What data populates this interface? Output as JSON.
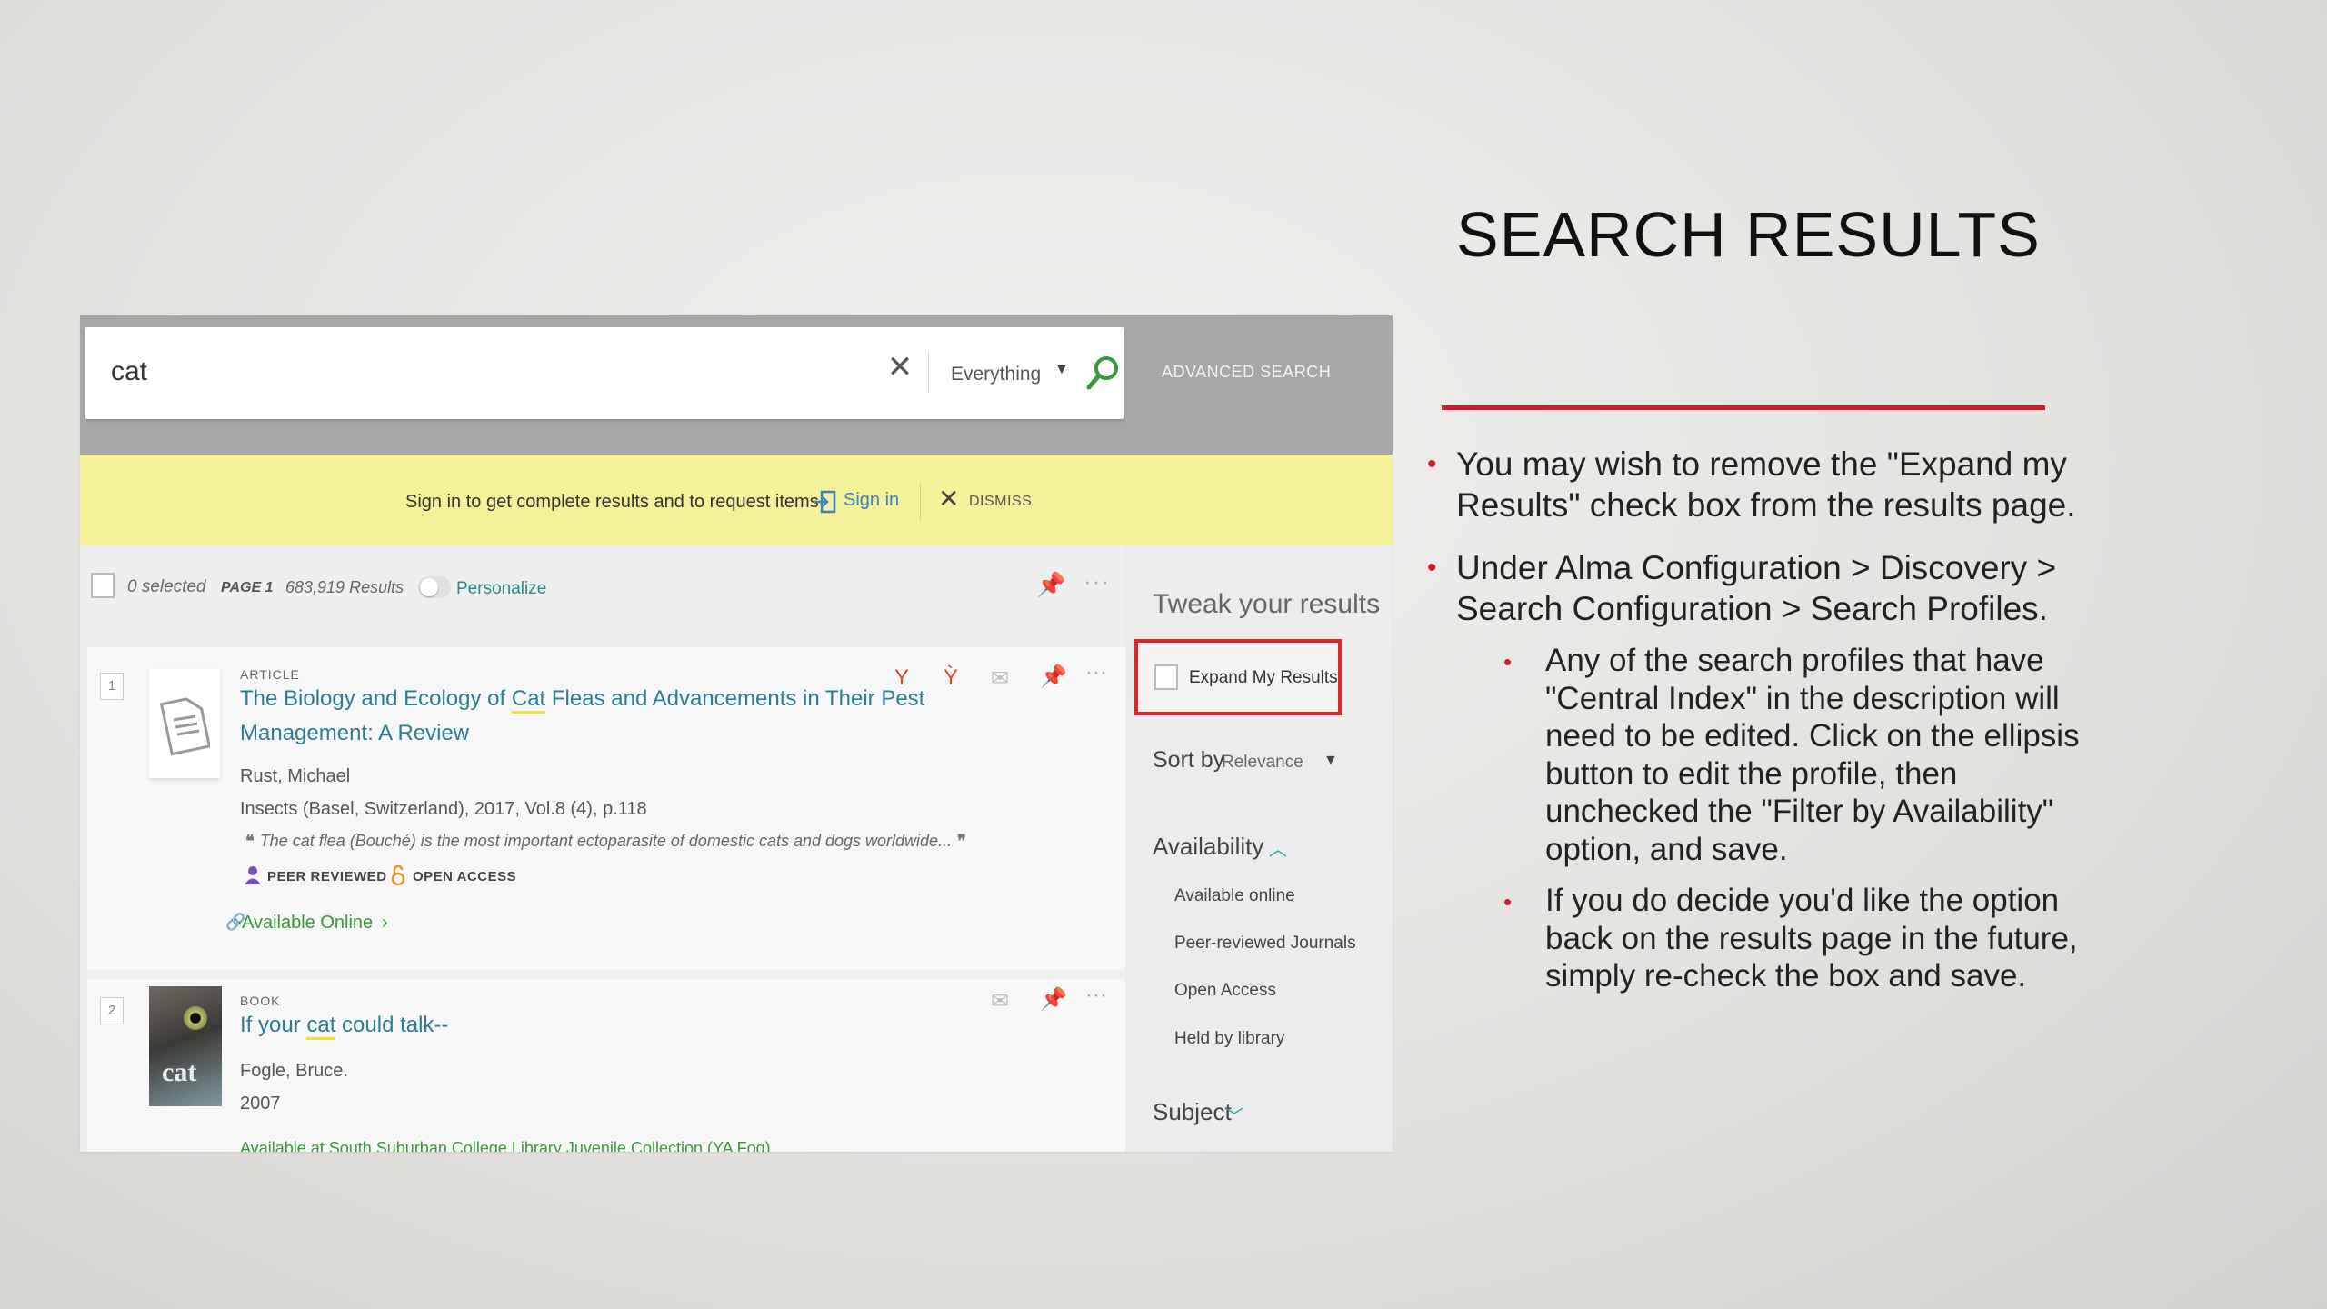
{
  "search": {
    "query": "cat",
    "scope": "Everything",
    "advanced_search": "ADVANCED SEARCH"
  },
  "banner": {
    "text": "Sign in to get complete results and to request items",
    "signin": "Sign in",
    "dismiss": "DISMISS"
  },
  "results_bar": {
    "selected": "0 selected",
    "page": "PAGE 1",
    "count": "683,919 Results",
    "personalize": "Personalize"
  },
  "results": [
    {
      "rank": "1",
      "type": "ARTICLE",
      "title_pre": "The Biology and Ecology of ",
      "title_hit": "Cat",
      "title_post": " Fleas and Advancements in Their Pest",
      "title_line2": "Management: A Review",
      "author": "Rust, Michael",
      "source": "Insects (Basel, Switzerland), 2017, Vol.8 (4), p.118",
      "snippet": "The cat flea (Bouché) is the most important ectoparasite of domestic cats and dogs worldwide...",
      "badge_peer": "PEER REVIEWED",
      "badge_open": "OPEN ACCESS",
      "availability": "Available Online"
    },
    {
      "rank": "2",
      "type": "BOOK",
      "title_pre": "If your ",
      "title_hit": "cat",
      "title_post": " could talk--",
      "author": "Fogle, Bruce.",
      "year": "2007",
      "availability": "Available at South Suburban College Library  Juvenile Collection (YA Fog)"
    }
  ],
  "sidebar": {
    "tweak_title": "Tweak your results",
    "expand_label": "Expand My Results",
    "sort_label": "Sort by",
    "sort_value": "Relevance",
    "availability_title": "Availability",
    "availability_items": [
      "Available online",
      "Peer-reviewed Journals",
      "Open Access",
      "Held by library"
    ],
    "subject_title": "Subject"
  },
  "slide": {
    "title": "SEARCH RESULTS",
    "bullet1_line1": "You may wish to remove the \"Expand my",
    "bullet1_line2": "Results\" check box from the results page.",
    "bullet2_line1": "Under Alma Configuration > Discovery >",
    "bullet2_line2": "Search Configuration > Search Profiles.",
    "sub1_lines": [
      " Any of the search profiles that have",
      "\"Central Index\" in the description will",
      "need to be edited. Click on the ellipsis",
      "button to edit the profile, then",
      "unchecked the \"Filter by Availability\"",
      "option, and save."
    ],
    "sub2_lines": [
      "If you do decide you'd like the option",
      "back on the results page in the future,",
      "simply re-check the box and save."
    ]
  },
  "colors": {
    "accent_red": "#c8202f",
    "highlight_red": "#e0242a",
    "banner_yellow": "#f5f09a",
    "link_teal": "#2b7d94"
  }
}
